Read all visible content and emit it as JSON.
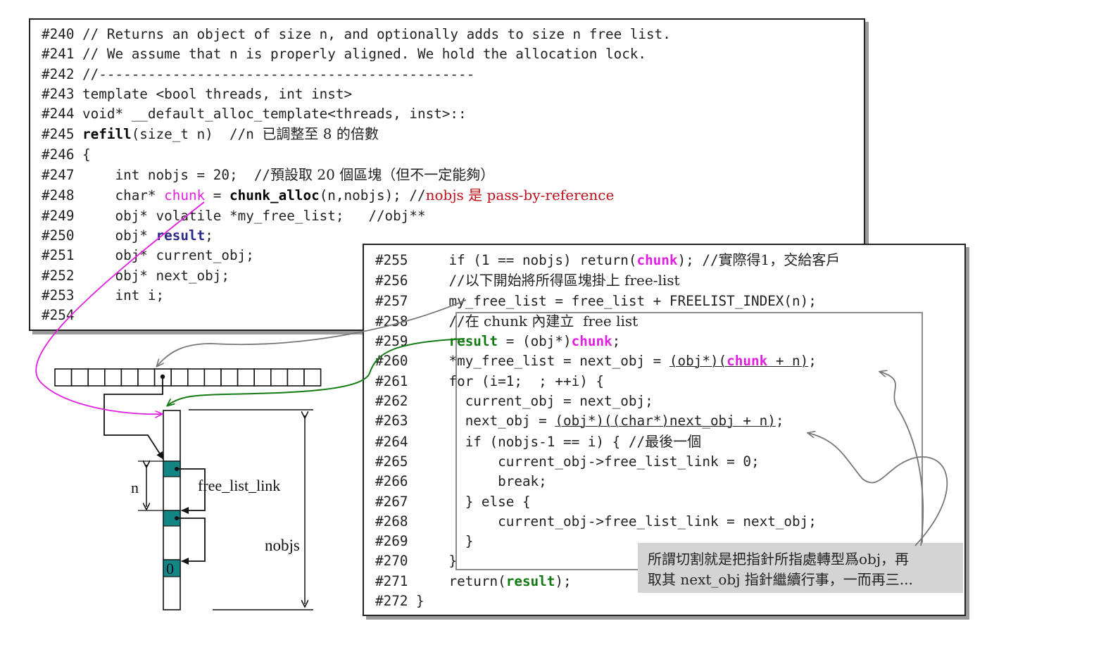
{
  "top_listing": {
    "l240": "#240 // Returns an object of size n, and optionally adds to size n free list.",
    "l241": "#241 // We assume that n is properly aligned. We hold the allocation lock.",
    "l242": "#242 //----------------------------------------------",
    "l243": "#243 template <bool threads, int inst>",
    "l244": "#244 void* __default_alloc_template<threads, inst>::",
    "l245_pre": "#245 ",
    "l245_kw": "refill",
    "l245_post": "(size_t n)  //n ",
    "l245_cjk": "已調整至 8 的倍數",
    "l246": "#246 {",
    "l247_pre": "#247     int nobjs = 20;  //",
    "l247_cjk": "預設取 20 個區塊（但不一定能夠）",
    "l248_pre": "#248     char* ",
    "l248_chunk": "chunk",
    "l248_mid": " = ",
    "l248_kw": "chunk_alloc",
    "l248_post": "(n,nobjs); //",
    "l248_note": "nobjs 是 pass-by-reference",
    "l249": "#249     obj* volatile *my_free_list;   //obj**",
    "l250_pre": "#250     obj* ",
    "l250_kw": "result",
    "l250_post": ";",
    "l251": "#251     obj* current_obj;",
    "l252": "#252     obj* next_obj;",
    "l253": "#253     int i;",
    "l254": "#254"
  },
  "bottom_listing": {
    "l255_pre": "#255     if (1 == nobjs) return(",
    "l255_chunk": "chunk",
    "l255_post": "); //",
    "l255_cjk": "實際得1，交給客戶",
    "l256_pre": "#256     //",
    "l256_cjk": "以下開始將所得區塊掛上 free-list",
    "l257": "#257     my_free_list = free_list + FREELIST_INDEX(n);",
    "l258_pre": "#258     //",
    "l258_cjk": "在 chunk 內建立  free list",
    "l259_pre": "#259     ",
    "l259_kw": "result",
    "l259_mid": " = (obj*)",
    "l259_chunk": "chunk",
    "l259_post": ";",
    "l260_pre": "#260     *my_free_list = next_obj = ",
    "l260_cast": "(obj*)(",
    "l260_chunk": "chunk",
    "l260_tail": " + n)",
    "l260_post": ";",
    "l261": "#261     for (i=1;  ; ++i) {",
    "l262": "#262       current_obj = next_obj;",
    "l263_pre": "#263       next_obj = ",
    "l263_expr": "(obj*)((char*)next_obj + n)",
    "l263_post": ";",
    "l264_pre": "#264       if (nobjs-1 == i) { //",
    "l264_cjk": "最後一個",
    "l265": "#265           current_obj->free_list_link = 0;",
    "l266": "#266           break;",
    "l267": "#267       } else {",
    "l268": "#268           current_obj->free_list_link = next_obj;",
    "l269": "#269       }",
    "l270": "#270     }",
    "l271_pre": "#271     return(",
    "l271_kw": "result",
    "l271_post": ");",
    "l272": "#272 }"
  },
  "note": {
    "line1": "所謂切割就是把指針所指處轉型爲obj，再",
    "line2": "取其 next_obj 指針繼續行事，一而再三..."
  },
  "diagram": {
    "n_label": "n",
    "link_label": "free_list_link",
    "nobjs_label": "nobjs",
    "zero_label": "0",
    "free_list_slots": 16,
    "block_fill": "#138585"
  },
  "colors": {
    "chunk": "#e020e0",
    "result": "#137a13",
    "note_bg": "#d4d4d4"
  }
}
